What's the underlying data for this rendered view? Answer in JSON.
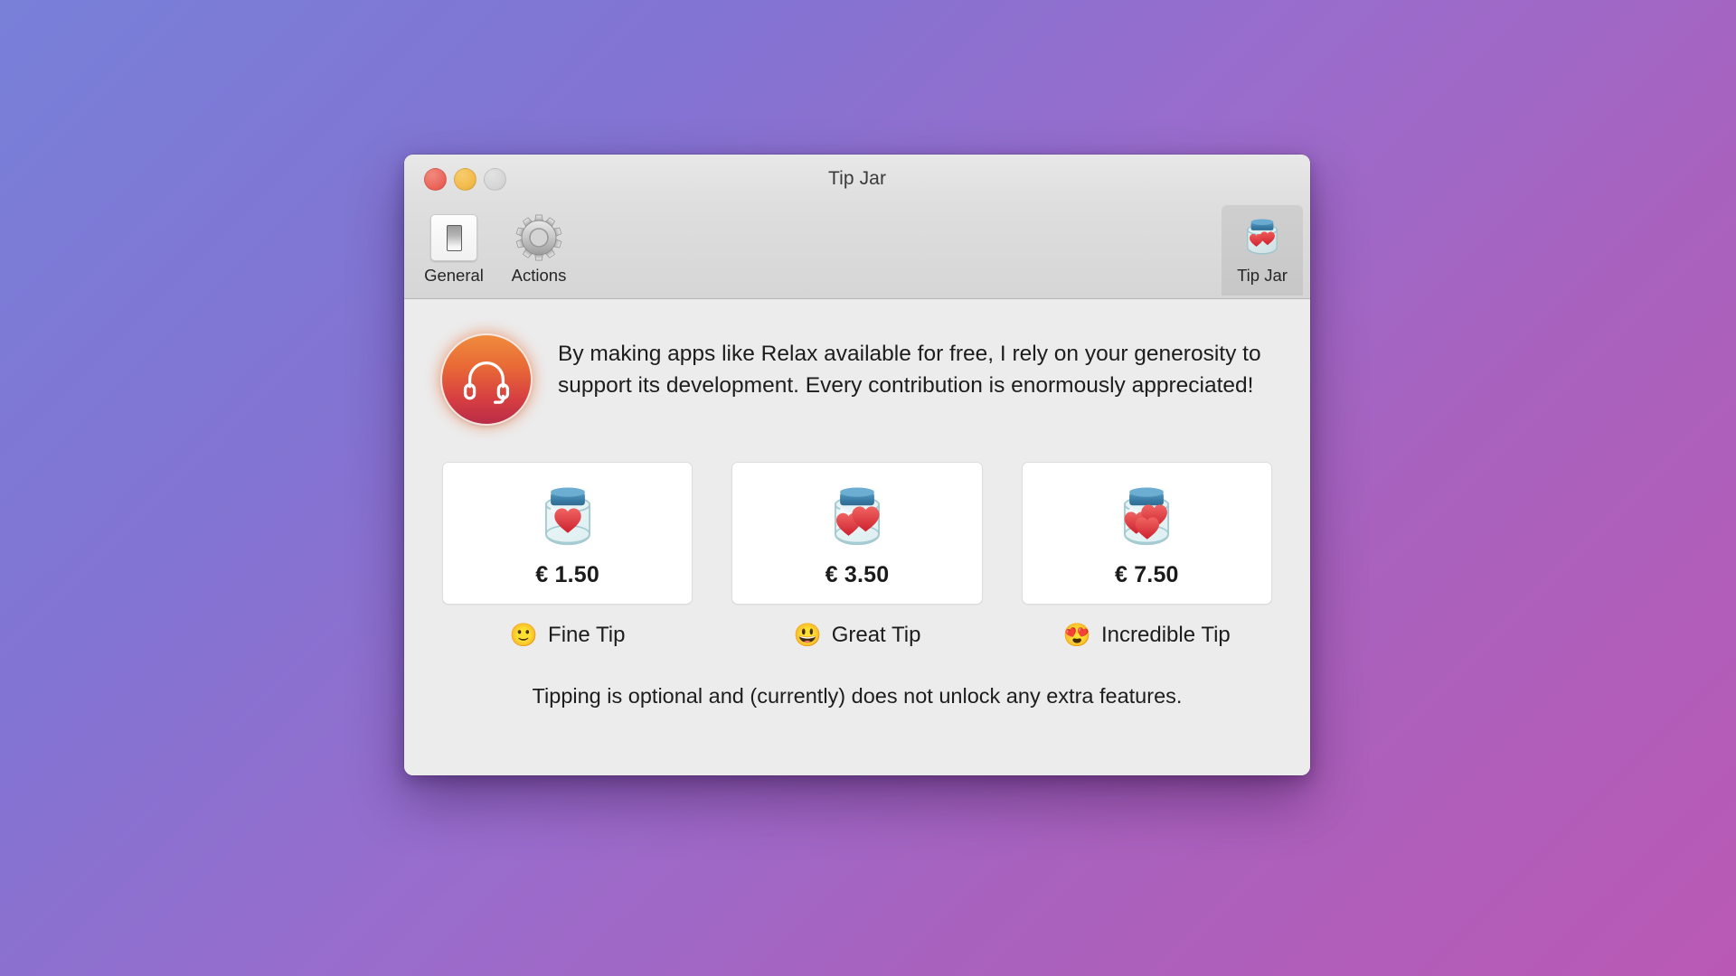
{
  "window": {
    "title": "Tip Jar",
    "traffic_lights": [
      {
        "name": "close",
        "color": "#ec6a5f"
      },
      {
        "name": "minimize",
        "color": "#f4bd4f"
      },
      {
        "name": "zoom",
        "color": "#d8d8d8"
      }
    ]
  },
  "toolbar": {
    "items": [
      {
        "label": "General",
        "icon": "light-switch-icon",
        "selected": false
      },
      {
        "label": "Actions",
        "icon": "gear-icon",
        "selected": false
      }
    ],
    "right_items": [
      {
        "label": "Tip Jar",
        "icon": "tip-jar-icon",
        "selected": true
      }
    ]
  },
  "main": {
    "app_icon": "headphones-icon",
    "intro_text": "By making apps like Relax available for free, I rely on your generosity to support its development. Every contribution is enormously appreciated!",
    "tips": [
      {
        "price": "€ 1.50",
        "caption": "Fine Tip",
        "emoji": "🙂",
        "emoji_name": "slightly-smiling-face",
        "hearts": 1
      },
      {
        "price": "€ 3.50",
        "caption": "Great Tip",
        "emoji": "😃",
        "emoji_name": "grinning-face-with-big-eyes",
        "hearts": 2
      },
      {
        "price": "€ 7.50",
        "caption": "Incredible Tip",
        "emoji": "😍",
        "emoji_name": "smiling-face-with-heart-eyes",
        "hearts": 3
      }
    ],
    "footer_note": "Tipping is optional and (currently) does not unlock any extra features."
  },
  "colors": {
    "desktop_gradient_start": "#7880d8",
    "desktop_gradient_end": "#b959b5",
    "window_background": "#ececec",
    "card_background": "#ffffff",
    "jar_lid": "#3c7ea8",
    "heart_red": "#e4373c",
    "app_icon_top": "#ef8b3c",
    "app_icon_bottom": "#b92b48"
  }
}
